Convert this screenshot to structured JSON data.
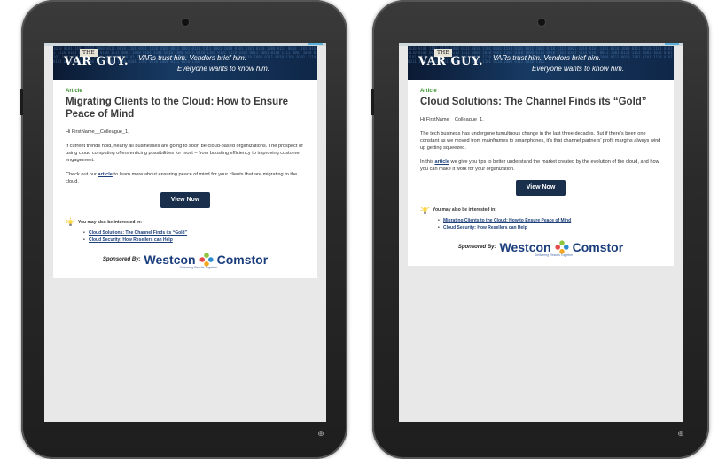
{
  "banner": {
    "logo_the": "THE",
    "logo_text": "VAR GUY.",
    "tagline_line1": "VARs trust him. Vendors brief him.",
    "tagline_line2": "Everyone wants to know him.",
    "bits": "1010 0101 1101 0110 1000 0111 0010 1101 0101 1110 0101 0011 1001 0110 1111 0001 1010 0101 1101 0110 1000 0111 0010 1101 0101 1110 0101 0011 1001 0110 1111 0001 1010 0101 1101 0110 1000 0111 0010 1101 0101 1110 0101 0011 1001 0110 1111 0001 1010 0101 1101 0110 1000 0111 0010 1101 0101 1110 0101 0011 1001 0110 1111 0001 1010 0101 1101 0110 1000 0111 0010 1101 0101 1110 0101 0011 1001 0110 1111 0001 1010 0101 1101 0110 1000 0111 0010 1101"
  },
  "emails": [
    {
      "label": "Article",
      "title": "Migrating Clients to the Cloud: How to Ensure Peace of Mind",
      "greeting": "Hi FirstName__Colleague_1,",
      "para1": "If current trends hold, nearly all businesses are going to soon be cloud-based organizations. The prospect of using cloud computing offers enticing possibilities for most – from boosting efficiency to improving customer engagement.",
      "para2_before": "Check out our ",
      "para2_link": "article",
      "para2_after": " to learn more about ensuring peace of mind for your clients that are migrating to the cloud.",
      "button": "View Now",
      "interest_label": "You may also be interested in:",
      "related": [
        "Cloud Solutions: The Channel Finds its “Gold”",
        "Cloud Security: How Resellers can Help"
      ]
    },
    {
      "label": "Article",
      "title": "Cloud Solutions: The Channel Finds its “Gold”",
      "greeting": "Hi FirstName__Colleague_1,",
      "para1": "The tech business has undergone tumultuous change in the last three decades. But if there’s been one constant as we moved from mainframes to smartphones, it’s that channel partners’ profit margins always wind up getting squeezed.",
      "para2_before": "In this ",
      "para2_link": "article",
      "para2_after": " we give you tips to better understand the market created by the evolution of the cloud, and how you can make it work for your organization.",
      "button": "View Now",
      "interest_label": "You may also be interested in:",
      "related": [
        "Migrating Clients to the Cloud: How to Ensure Peace of Mind",
        "Cloud Security: How Resellers can Help"
      ]
    }
  ],
  "sponsor": {
    "by": "Sponsored By:",
    "westcon": "Westcon",
    "comstor": "Comstor",
    "tagline": "Delivering Results Together"
  },
  "colors": {
    "accent_green": "#3a8f2e",
    "button_navy": "#1a2f4b",
    "link_blue": "#1d3f7a"
  }
}
